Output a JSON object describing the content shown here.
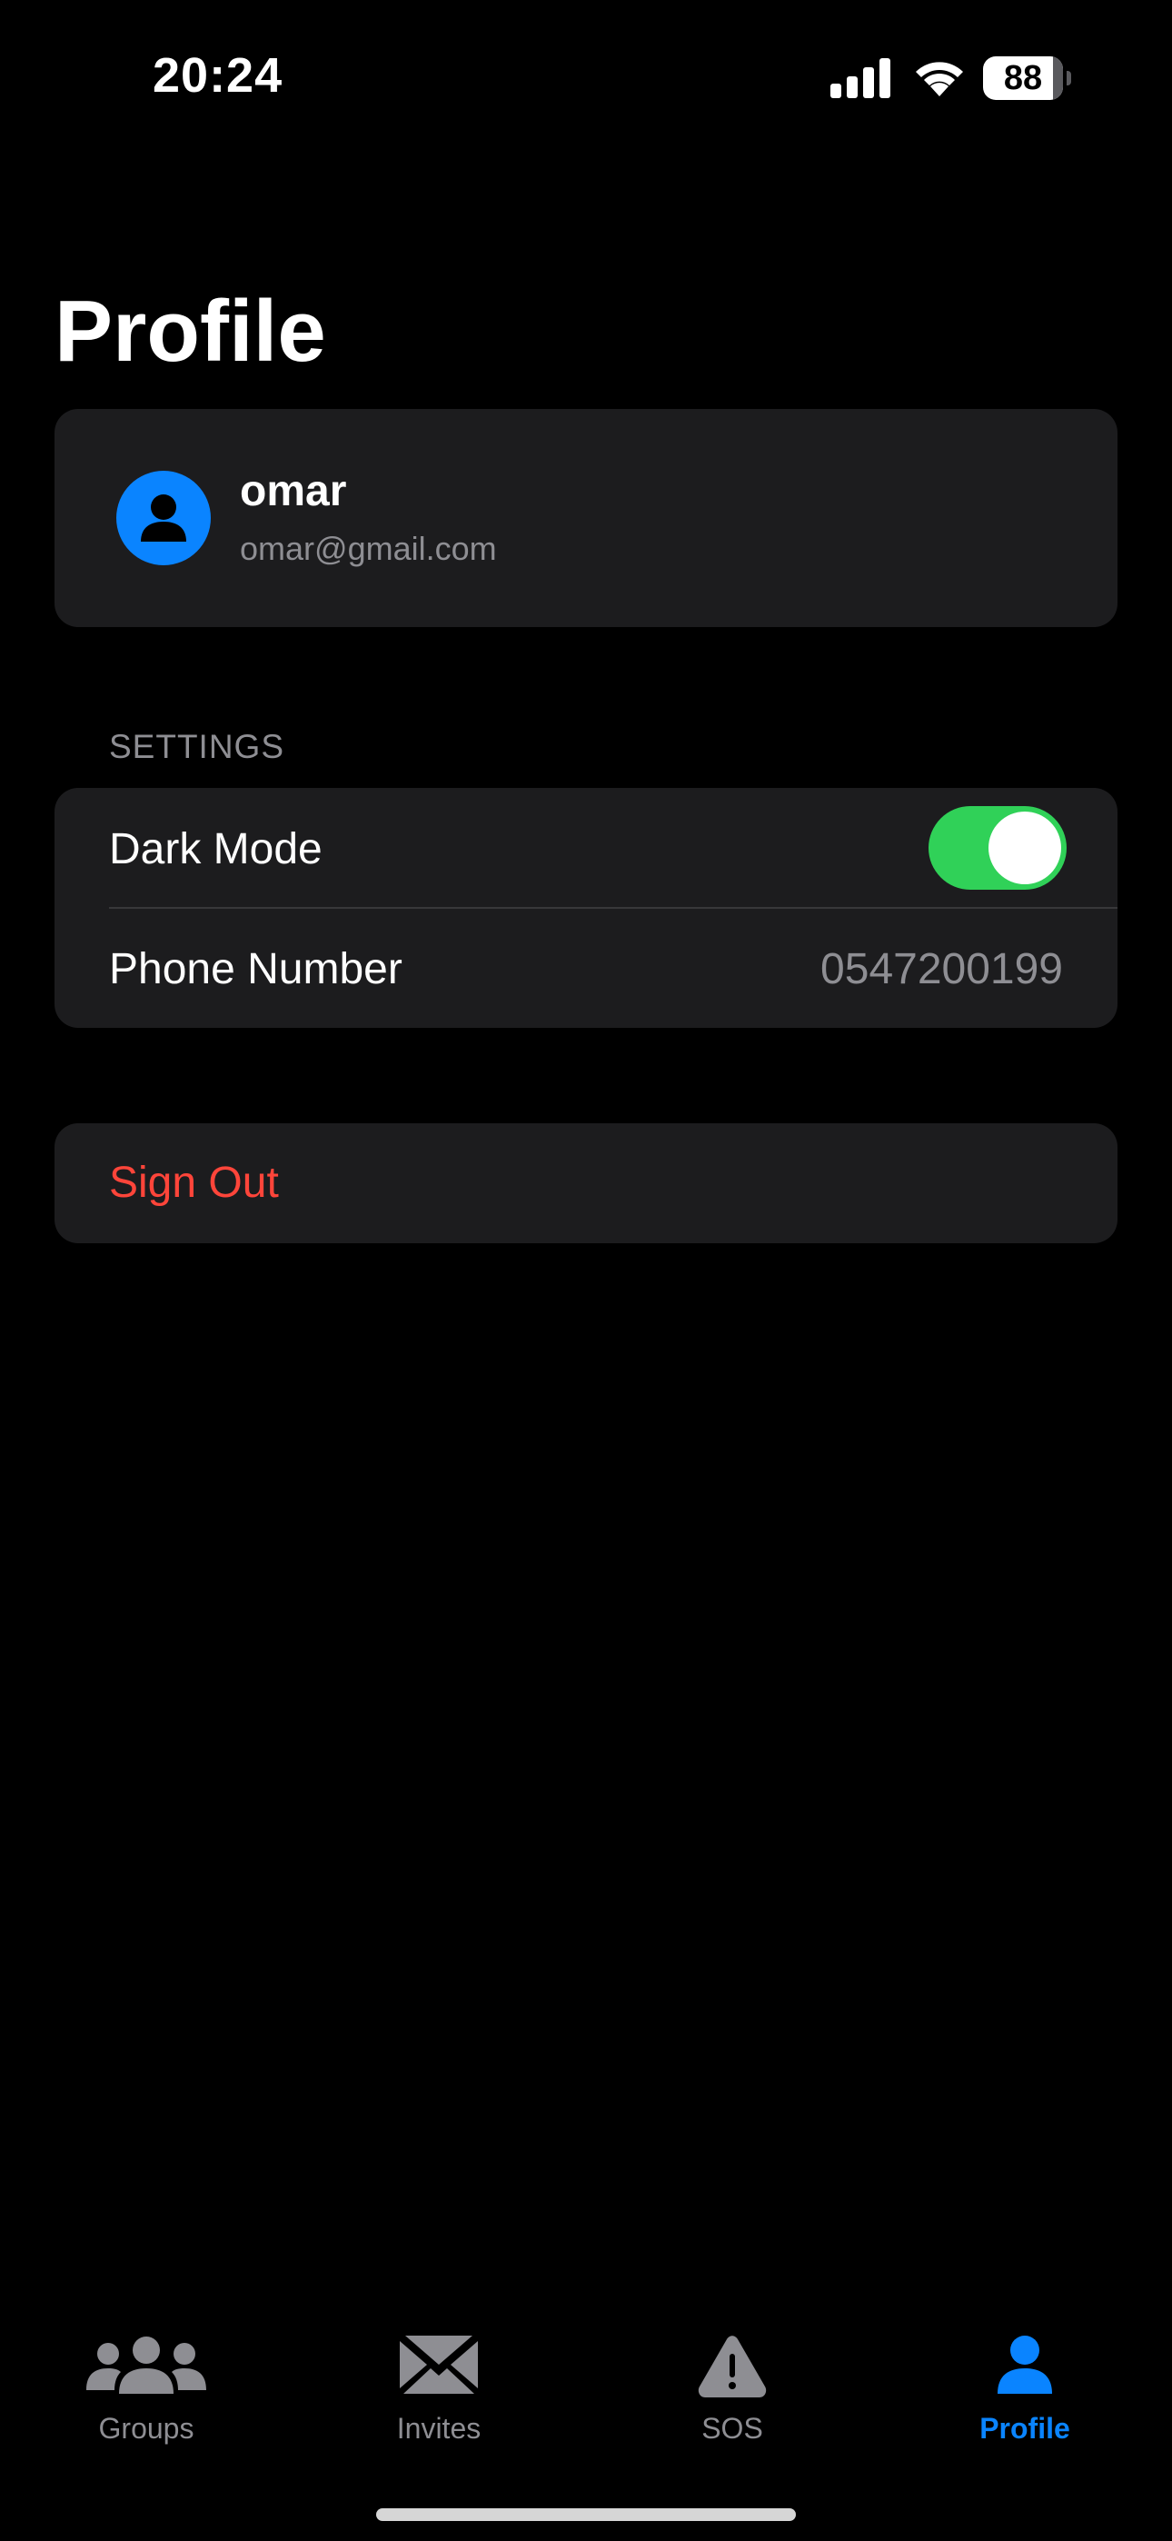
{
  "status_bar": {
    "time": "20:24",
    "battery_level": "88",
    "battery_fraction": 0.88,
    "signal_icon": "cellular-signal-icon",
    "wifi_icon": "wifi-icon"
  },
  "header": {
    "title": "Profile"
  },
  "profile": {
    "avatar_icon": "person-icon",
    "name": "omar",
    "email": "omar@gmail.com"
  },
  "settings": {
    "section_title": "SETTINGS",
    "dark_mode": {
      "label": "Dark Mode",
      "enabled": true
    },
    "phone": {
      "label": "Phone Number",
      "value": "0547200199"
    }
  },
  "sign_out": {
    "label": "Sign Out"
  },
  "tab_bar": {
    "tabs": [
      {
        "label": "Groups",
        "icon": "people-icon",
        "active": false
      },
      {
        "label": "Invites",
        "icon": "envelope-icon",
        "active": false
      },
      {
        "label": "SOS",
        "icon": "warning-triangle-icon",
        "active": false
      },
      {
        "label": "Profile",
        "icon": "person-icon",
        "active": true
      }
    ]
  },
  "colors": {
    "background": "#000000",
    "card": "#1c1c1e",
    "accent": "#0a84ff",
    "toggle_on": "#30d158",
    "destructive": "#ff453a",
    "secondary_text": "#8e8e93",
    "inactive_tab": "#8e8e93"
  }
}
